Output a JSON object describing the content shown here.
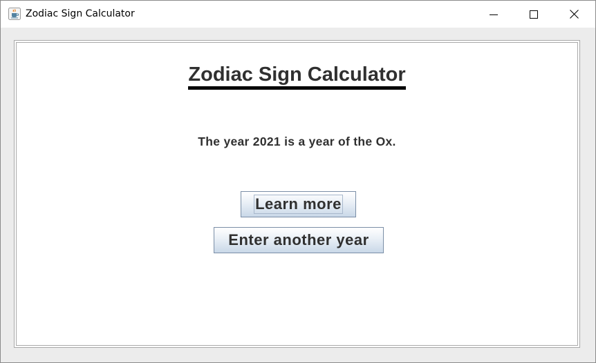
{
  "window": {
    "title": "Zodiac Sign Calculator",
    "controls": {
      "minimize": "minimize-icon",
      "maximize": "maximize-icon",
      "close": "close-icon"
    },
    "app_icon": "java-coffee-cup-icon"
  },
  "panel": {
    "heading": "Zodiac Sign Calculator",
    "result": "The year 2021 is a year of the Ox.",
    "learn_more_label": "Learn more",
    "enter_another_label": "Enter another year"
  },
  "colors": {
    "text": "#303030",
    "button_border": "#7a8ea6",
    "button_gradient_bottom": "#c9d8e8"
  }
}
